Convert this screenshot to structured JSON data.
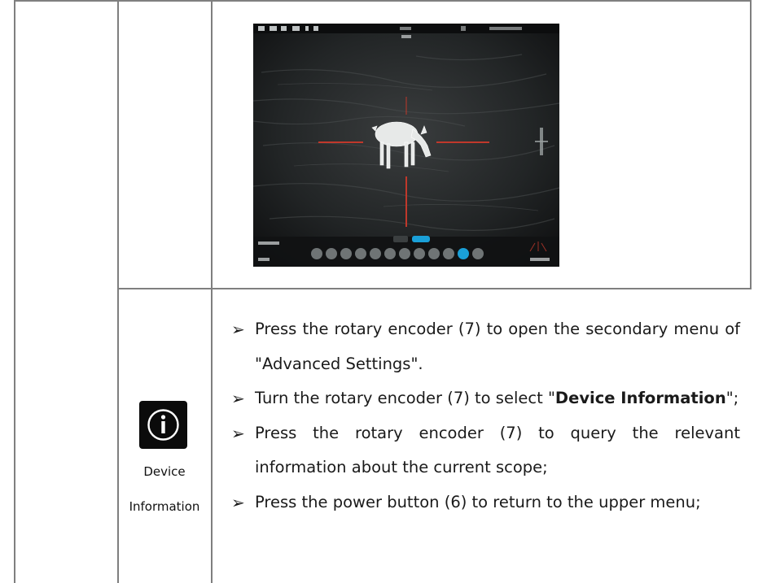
{
  "section": {
    "feature_name_line1": "Device",
    "feature_name_line2": "Information",
    "icon": "info-circle-icon"
  },
  "steps": [
    {
      "text": "Press the rotary encoder (7) to open the secondary menu of \"Advanced Settings\"."
    },
    {
      "prefix": "Turn the rotary encoder (7) to select \"",
      "bold": "Device Information",
      "suffix": "\";"
    },
    {
      "text": "Press the rotary encoder (7) to query the relevant information about the current scope;"
    },
    {
      "text": "Press the power button (6) to return to the upper menu;"
    }
  ],
  "colors": {
    "table_border": "#7f7f7f",
    "screen_bg": "#151718",
    "reticle_red": "#c0382b",
    "highlight_blue": "#1aa0d8"
  }
}
